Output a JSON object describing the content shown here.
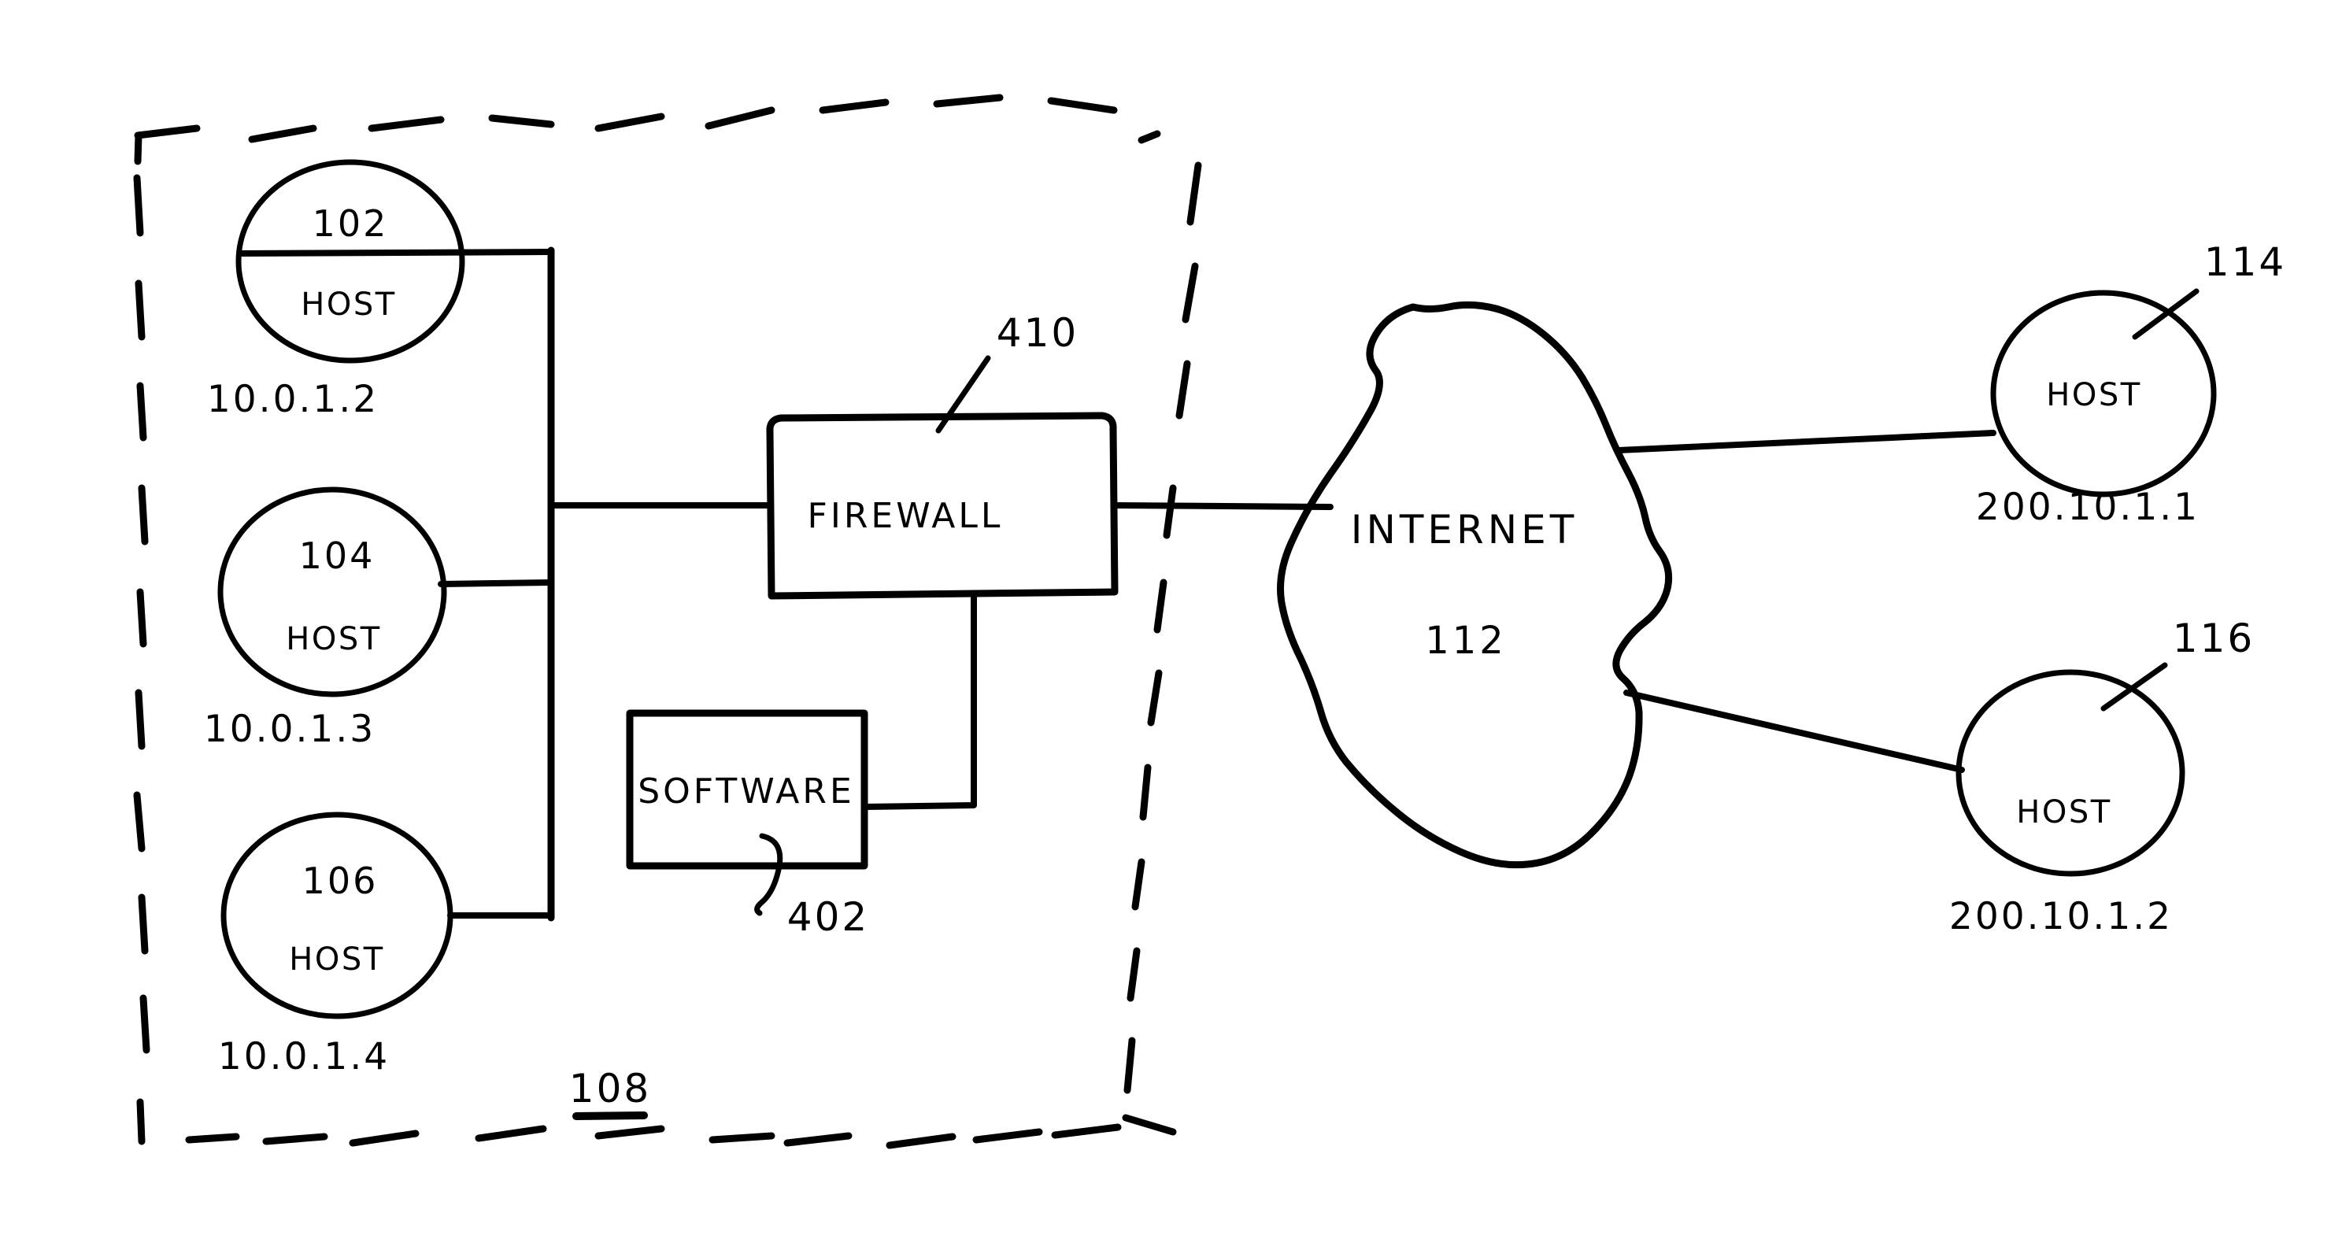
{
  "diagram": {
    "title": "Network security diagram with firewall and software module",
    "style": "hand-drawn ink on white",
    "boundary": {
      "name": "protected-network-boundary",
      "style": "dashed",
      "ref_label": "108",
      "ref_underlined": true
    },
    "internal_hosts": [
      {
        "ref": "102",
        "type": "HOST",
        "ip": "10.0.1.2"
      },
      {
        "ref": "104",
        "type": "HOST",
        "ip": "10.0.1.3"
      },
      {
        "ref": "106",
        "type": "HOST",
        "ip": "10.0.1.4"
      }
    ],
    "external_hosts": [
      {
        "ref": "114",
        "type": "HOST",
        "ip": "200.10.1.1"
      },
      {
        "ref": "116",
        "type": "HOST",
        "ip": "200.10.1.2"
      }
    ],
    "firewall": {
      "label": "FIREWALL",
      "ref": "410"
    },
    "software": {
      "label": "SOFTWARE",
      "ref": "402"
    },
    "cloud": {
      "label": "INTERNET",
      "ref": "112"
    },
    "colors": {
      "ink": "#000000",
      "background": "#ffffff"
    }
  }
}
